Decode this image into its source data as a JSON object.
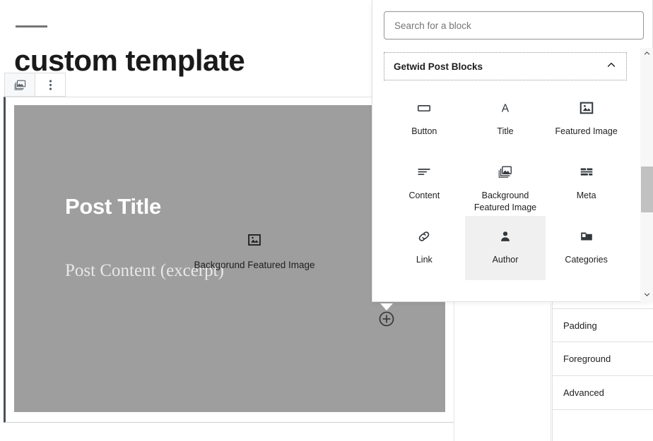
{
  "editor": {
    "page_title": "custom template",
    "toolbar": {
      "block_type_label": "gallery-block-type",
      "options_label": "more-options"
    },
    "preview": {
      "post_title": "Post Title",
      "post_content": "Post Content (excerpt)"
    },
    "drag_ghost": {
      "label": "Backgorund Featured Image",
      "icon": "featured-image-icon"
    },
    "drop_cursor_icon": "circle-plus-icon"
  },
  "sidebar": {
    "rows": [
      {
        "label": "Padding"
      },
      {
        "label": "Foreground"
      },
      {
        "label": "Advanced"
      }
    ]
  },
  "inserter": {
    "search": {
      "placeholder": "Search for a block",
      "value": ""
    },
    "panel": {
      "title": "Getwid Post Blocks",
      "expanded": true,
      "chevron_icon": "chevron-up-icon"
    },
    "blocks": [
      {
        "label": "Button",
        "icon": "button-icon",
        "selected": false
      },
      {
        "label": "Title",
        "icon": "letter-a-icon",
        "selected": false
      },
      {
        "label": "Featured Image",
        "icon": "featured-image-icon",
        "selected": false
      },
      {
        "label": "Content",
        "icon": "text-lines-icon",
        "selected": false
      },
      {
        "label": "Background Featured Image",
        "icon": "stacked-images-icon",
        "selected": false
      },
      {
        "label": "Meta",
        "icon": "meta-bars-icon",
        "selected": false
      },
      {
        "label": "Link",
        "icon": "chain-link-icon",
        "selected": false
      },
      {
        "label": "Author",
        "icon": "person-icon",
        "selected": true
      },
      {
        "label": "Categories",
        "icon": "folder-icon",
        "selected": false
      }
    ]
  },
  "scrollbar": {
    "up_icon": "chevron-up-icon",
    "down_icon": "chevron-down-icon"
  },
  "colors": {
    "accent_selected_block": "#4a5157",
    "placeholder_block": "#9e9e9e",
    "panel_border": "#e0e0e0",
    "selected_item_bg": "#f0f0f0",
    "scroll_thumb": "#c1c1c1"
  }
}
